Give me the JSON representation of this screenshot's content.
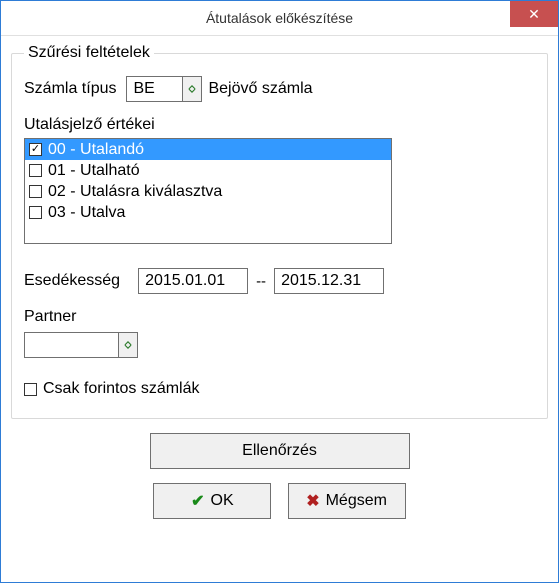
{
  "window": {
    "title": "Átutalások előkészítése"
  },
  "group": {
    "legend": "Szűrési feltételek",
    "account_type": {
      "label": "Számla típus",
      "value": "BE",
      "description": "Bejövő számla"
    },
    "indicator": {
      "label": "Utalásjelző értékei",
      "items": [
        {
          "label": "00 - Utalandó",
          "checked": true,
          "selected": true
        },
        {
          "label": "01 - Utalható",
          "checked": false,
          "selected": false
        },
        {
          "label": "02 - Utalásra kiválasztva",
          "checked": false,
          "selected": false
        },
        {
          "label": "03 - Utalva",
          "checked": false,
          "selected": false
        }
      ]
    },
    "duedate": {
      "label": "Esedékesség",
      "from": "2015.01.01",
      "sep": "--",
      "to": "2015.12.31"
    },
    "partner": {
      "label": "Partner",
      "value": ""
    },
    "only_huf": {
      "label": "Csak forintos számlák",
      "checked": false
    }
  },
  "buttons": {
    "check": "Ellenőrzés",
    "ok": "OK",
    "cancel": "Mégsem"
  },
  "chart_data": null
}
